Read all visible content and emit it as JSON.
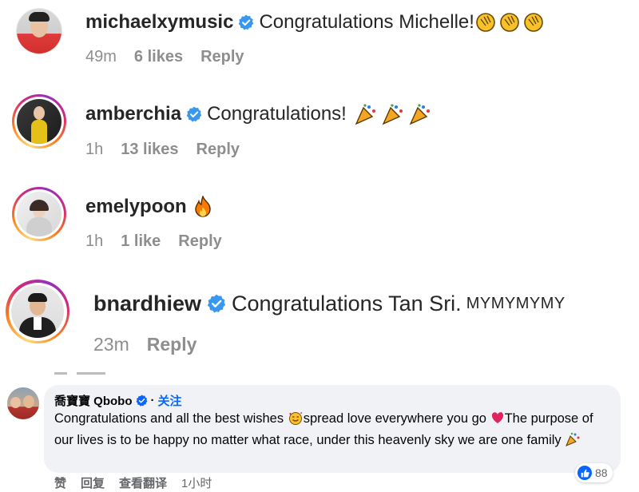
{
  "comments": [
    {
      "username": "michaelxymusic",
      "verified": true,
      "text": "Congratulations Michelle!",
      "emoji": [
        "clapping-hands",
        "clapping-hands",
        "clapping-hands"
      ],
      "time": "49m",
      "likes": "6 likes",
      "reply": "Reply"
    },
    {
      "username": "amberchia",
      "verified": true,
      "text": "Congratulations!",
      "emoji": [
        "party-popper",
        "party-popper",
        "party-popper"
      ],
      "time": "1h",
      "likes": "13 likes",
      "reply": "Reply"
    },
    {
      "username": "emelypoon",
      "verified": false,
      "text": "",
      "emoji": [
        "fire"
      ],
      "time": "1h",
      "likes": "1 like",
      "reply": "Reply"
    },
    {
      "username": "bnardhiew",
      "verified": true,
      "text": "Congratulations Tan Sri.",
      "suffix": "MYMYMYMY",
      "time": "23m",
      "reply": "Reply"
    }
  ],
  "fb_comment": {
    "name": "喬寶寶 Qbobo",
    "verified": true,
    "separator": "·",
    "follow": "关注",
    "text_1": "Congratulations and all the best wishes ",
    "text_2": "spread love everywhere you go ",
    "text_3": "The purpose of our lives is to be happy no matter what race, under this heavenly sky we are one family ",
    "reaction_count": "88",
    "actions": {
      "like": "赞",
      "reply": "回复",
      "translate": "查看翻译",
      "time": "1小时"
    }
  },
  "colors": {
    "verified_blue": "#3897f0",
    "fb_blue": "#0866ff",
    "meta_gray": "#8e8e8e"
  }
}
